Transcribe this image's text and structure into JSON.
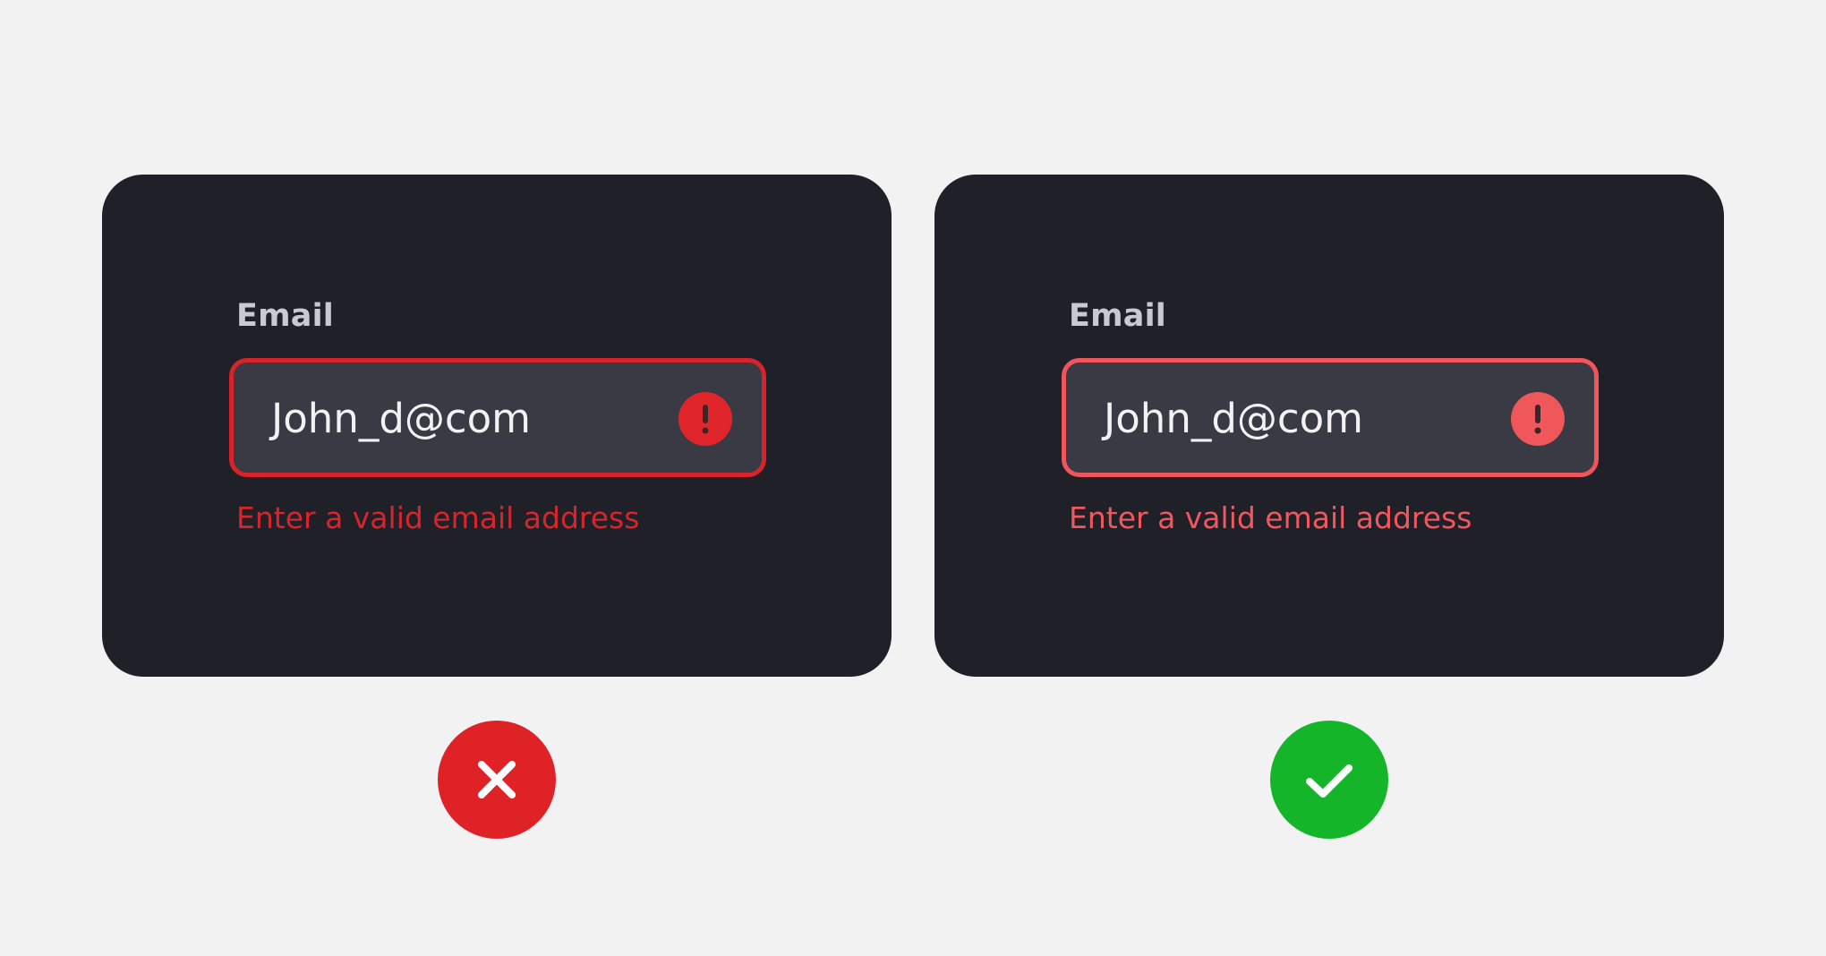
{
  "examples": [
    {
      "variant": "incorrect",
      "label": "Email",
      "value": "John_d@com",
      "error": "Enter a valid email address",
      "border_color": "#d8232a",
      "icon_color": "#e0262b",
      "error_color": "#d8252b",
      "icon": "exclamation-icon"
    },
    {
      "variant": "correct",
      "label": "Email",
      "value": "John_d@com",
      "error": "Enter a valid email address",
      "border_color": "#f0555b",
      "icon_color": "#f0575b",
      "error_color": "#f0585d",
      "icon": "exclamation-icon"
    }
  ],
  "verdicts": [
    {
      "icon": "cross-icon",
      "color": "#de2226"
    },
    {
      "icon": "checkmark-icon",
      "color": "#15b52a"
    }
  ],
  "colors": {
    "page_background": "#f2f2f2",
    "card_background": "#1f2028",
    "input_background": "#393a43",
    "label_text": "#c9cacf",
    "input_text": "#f2f2f4"
  }
}
